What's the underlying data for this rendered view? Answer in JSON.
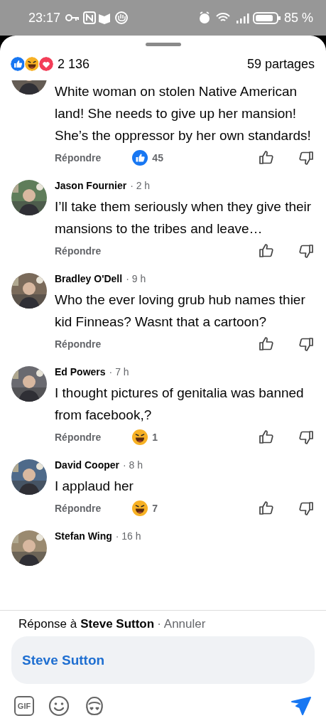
{
  "status_bar": {
    "time": "23:17",
    "battery": "85 %"
  },
  "post_stats": {
    "reactions": [
      {
        "kind": "like"
      },
      {
        "kind": "haha"
      },
      {
        "kind": "love"
      }
    ],
    "reaction_count": "2 136",
    "shares": "59 partages"
  },
  "comments": [
    {
      "text": "White woman on stolen Native American land! She needs to give up her mansion! She’s the oppressor by her own standards!",
      "reply": "Répondre",
      "reaction": {
        "kind": "like",
        "count": "45"
      }
    },
    {
      "author": "Jason Fournier",
      "time": "· 2 h",
      "text": "I’ll take them seriously when they give their mansions to the tribes and leave…",
      "reply": "Répondre"
    },
    {
      "author": "Bradley O'Dell",
      "time": "· 9 h",
      "text": "Who the ever loving grub hub names thier kid Finneas? Wasnt that a cartoon?",
      "reply": "Répondre"
    },
    {
      "author": "Ed Powers",
      "time": "· 7 h",
      "text": "I thought pictures of genitalia was banned from facebook,?",
      "reply": "Répondre",
      "reaction": {
        "kind": "haha",
        "count": "1"
      }
    },
    {
      "author": "David Cooper",
      "time": "· 8 h",
      "text": "I applaud her",
      "reply": "Répondre",
      "reaction": {
        "kind": "haha",
        "count": "7"
      }
    },
    {
      "author": "Stefan Wing",
      "time": "· 16 h"
    }
  ],
  "reply_bar": {
    "prefix": "Réponse à",
    "name": "Steve Sutton",
    "separator": "·",
    "cancel": "Annuler"
  },
  "composer": {
    "value": "Steve Sutton",
    "gif_label": "GIF"
  }
}
